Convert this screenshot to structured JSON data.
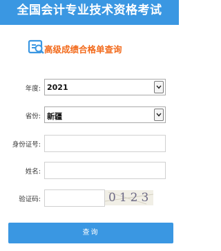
{
  "header": {
    "title": "全国会计专业技术资格考试"
  },
  "subtitle": {
    "text": "高级成绩合格单查询",
    "icon": "search-document-icon",
    "color": "#f26a1b"
  },
  "form": {
    "year": {
      "label": "年度:",
      "value": "2021"
    },
    "province": {
      "label": "省份:",
      "value": "新疆"
    },
    "id_number": {
      "label": "身份证号:",
      "value": ""
    },
    "name": {
      "label": "姓名:",
      "value": ""
    },
    "captcha": {
      "label": "验证码:",
      "value": "",
      "image_text": "0123"
    }
  },
  "submit": {
    "label": "查询"
  },
  "colors": {
    "primary": "#3a97e2",
    "accent": "#f26a1b"
  }
}
